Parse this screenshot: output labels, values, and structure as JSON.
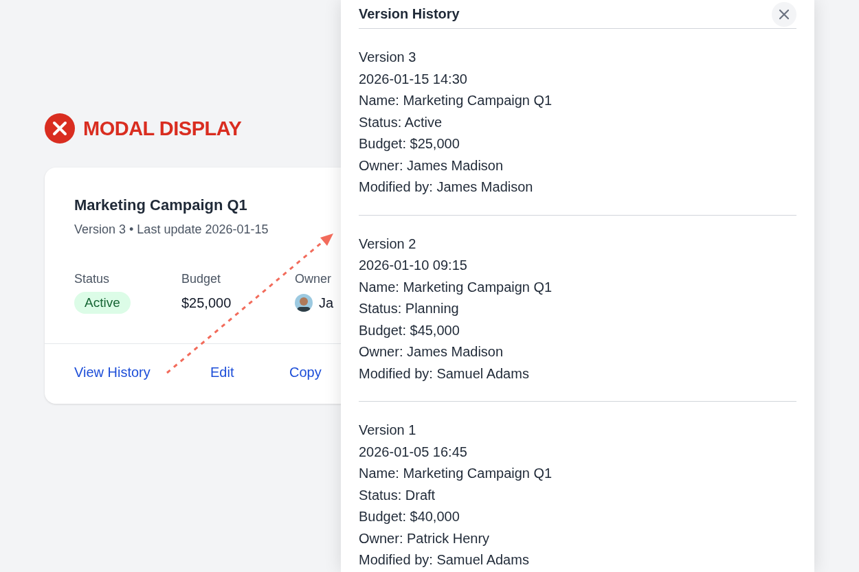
{
  "banner": {
    "kind": "error",
    "text": "MODAL DISPLAY"
  },
  "card": {
    "title": "Marketing Campaign Q1",
    "subtitle": "Version 3 • Last update 2026-01-15",
    "fields": [
      {
        "kind": "badge",
        "label": "Status",
        "value": "Active"
      },
      {
        "kind": "text",
        "label": "Budget",
        "value": "$25,000"
      },
      {
        "kind": "person",
        "label": "Owner",
        "value": "Ja"
      }
    ],
    "actions": [
      "View History",
      "Edit",
      "Copy"
    ]
  },
  "modal": {
    "title": "Version History",
    "versions": [
      {
        "lines": [
          "Version 3",
          "2026-01-15 14:30",
          "Name: Marketing Campaign Q1",
          "Status: Active",
          "Budget: $25,000",
          "Owner: James Madison",
          "Modified by: James Madison"
        ]
      },
      {
        "lines": [
          "Version 2",
          "2026-01-10 09:15",
          "Name: Marketing Campaign Q1",
          "Status: Planning",
          "Budget: $45,000",
          "Owner: James Madison",
          "Modified by: Samuel Adams"
        ]
      },
      {
        "lines": [
          "Version 1",
          "2026-01-05 16:45",
          "Name: Marketing Campaign Q1",
          "Status: Draft",
          "Budget: $40,000",
          "Owner: Patrick Henry",
          "Modified by: Samuel Adams"
        ]
      }
    ]
  }
}
